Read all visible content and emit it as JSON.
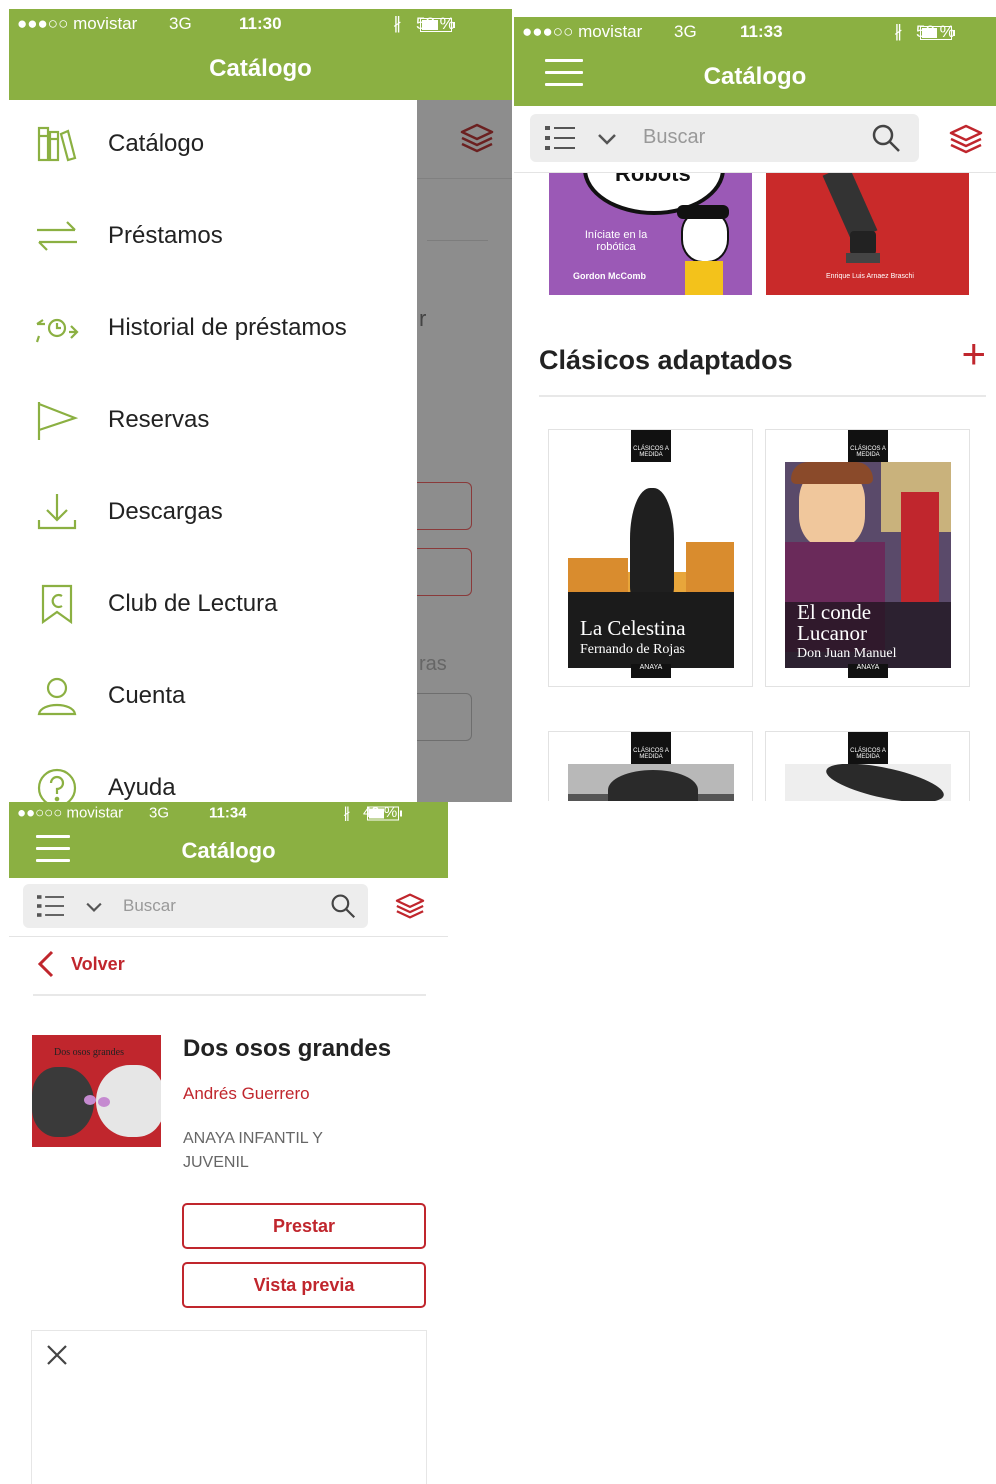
{
  "screen1": {
    "status": {
      "carrier": "●●●○○ movistar",
      "network": "3G",
      "time": "11:30",
      "battery": "52 %"
    },
    "nav_title": "Catálogo",
    "menu": [
      {
        "label": "Catálogo",
        "icon": "books-icon"
      },
      {
        "label": "Préstamos",
        "icon": "swap-arrows-icon"
      },
      {
        "label": "Historial de préstamos",
        "icon": "history-icon"
      },
      {
        "label": "Reservas",
        "icon": "flag-icon"
      },
      {
        "label": "Descargas",
        "icon": "download-icon"
      },
      {
        "label": "Club de Lectura",
        "icon": "bookmark-icon"
      },
      {
        "label": "Cuenta",
        "icon": "user-icon"
      },
      {
        "label": "Ayuda",
        "icon": "help-icon"
      }
    ],
    "behind_text_1": "r",
    "behind_text_2": "ras"
  },
  "screen2": {
    "status": {
      "carrier": "●●●○○ movistar",
      "network": "3G",
      "time": "11:33",
      "battery": "50 %"
    },
    "nav_title": "Catálogo",
    "search_placeholder": "Buscar",
    "top_books": [
      {
        "title": "Robots",
        "tagline": "Iníciate en la robótica",
        "author": "Gordon McComb",
        "color": "#9b59b6"
      },
      {
        "title": "",
        "author": "Enrique Luis Arnaez Braschi",
        "color": "#c92a2a"
      }
    ],
    "section_title": "Clásicos adaptados",
    "section_add": "+",
    "books": [
      {
        "series": "CLÁSICOS A MEDIDA",
        "title": "La Celestina",
        "author": "Fernando de Rojas",
        "publisher": "ANAYA"
      },
      {
        "series": "CLÁSICOS A MEDIDA",
        "title": "El conde Lucanor",
        "author": "Don Juan Manuel",
        "publisher": "ANAYA"
      },
      {
        "series": "CLÁSICOS A MEDIDA"
      },
      {
        "series": "CLÁSICOS A MEDIDA"
      }
    ]
  },
  "screen3": {
    "status": {
      "carrier": "●●○○○ movistar",
      "network": "3G",
      "time": "11:34",
      "battery": "49 %"
    },
    "nav_title": "Catálogo",
    "search_placeholder": "Buscar",
    "back_label": "Volver",
    "book": {
      "cover_title": "Dos osos grandes",
      "title": "Dos osos grandes",
      "author": "Andrés Guerrero",
      "publisher": "ANAYA INFANTIL Y JUVENIL"
    },
    "buttons": {
      "borrow": "Prestar",
      "preview": "Vista previa"
    },
    "close_icon": "close-icon"
  },
  "colors": {
    "accent_green": "#8bb042",
    "accent_red": "#c0262d"
  }
}
